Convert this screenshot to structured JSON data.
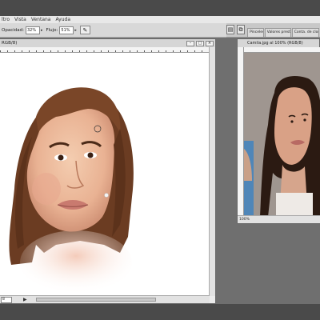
{
  "menu": {
    "items": [
      "ltro",
      "Vista",
      "Ventana",
      "Ayuda"
    ]
  },
  "options": {
    "opacity_label": "Opacidad:",
    "opacity_value": "32%",
    "flow_label": "Flujo:",
    "flow_value": "51%"
  },
  "panels": {
    "tabs": [
      "Pinceles",
      "Valores prest...",
      "Conta. de clona"
    ]
  },
  "main_doc": {
    "title": "RGB/8)",
    "zoom": "8"
  },
  "second_doc": {
    "title": "Camila.jpg al 100% (RGB/8)",
    "zoom": "100%"
  },
  "colors": {
    "app_dark": "#4a4a4a",
    "workspace": "#6f6f6f",
    "canvas": "#ffffff"
  }
}
